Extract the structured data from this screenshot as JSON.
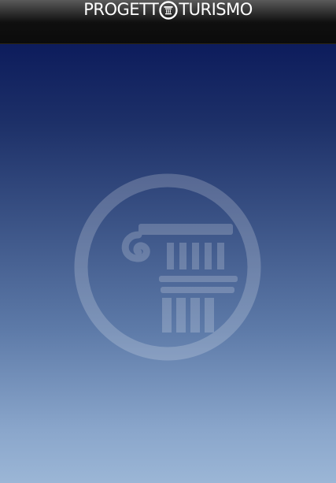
{
  "header": {
    "brand_left": "PROGETT",
    "brand_right": "TURISMO",
    "mark_icon": "colonna-logo-icon"
  },
  "colors": {
    "header_top": "#5a5a5a",
    "header_bottom": "#0b0b0b",
    "background_top": "#0d1c5c",
    "background_bottom": "#9bb6d6",
    "emblem": "#ffffff"
  },
  "emblem": {
    "icon": "ionic-column-watermark-icon"
  }
}
